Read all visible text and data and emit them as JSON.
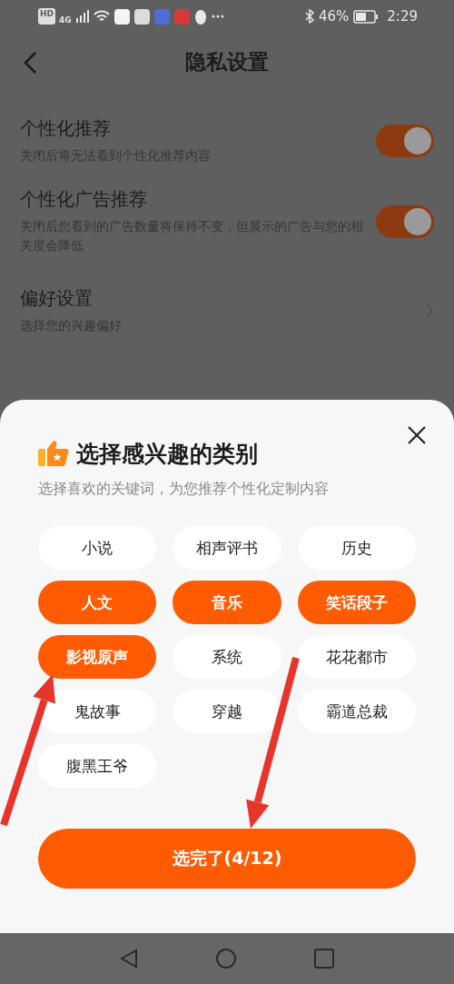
{
  "status_bar": {
    "indicators": [
      "HD",
      "4G"
    ],
    "battery": "46%",
    "time": "2:29"
  },
  "header": {
    "title": "隐私设置"
  },
  "settings": [
    {
      "kind": "toggle",
      "title": "个性化推荐",
      "subtitle": "关闭后将无法看到个性化推荐内容",
      "on": true
    },
    {
      "kind": "toggle",
      "title": "个性化广告推荐",
      "subtitle": "关闭后您看到的广告数量将保持不变，但展示的广告与您的相关度会降低",
      "on": true
    },
    {
      "kind": "link",
      "title": "偏好设置",
      "subtitle": "选择您的兴趣偏好"
    }
  ],
  "sheet": {
    "title": "选择感兴趣的类别",
    "subtitle": "选择喜欢的关键词，为您推荐个性化定制内容",
    "chips": [
      {
        "label": "小说",
        "selected": false
      },
      {
        "label": "相声评书",
        "selected": false
      },
      {
        "label": "历史",
        "selected": false
      },
      {
        "label": "人文",
        "selected": true
      },
      {
        "label": "音乐",
        "selected": true
      },
      {
        "label": "笑话段子",
        "selected": true
      },
      {
        "label": "影视原声",
        "selected": true
      },
      {
        "label": "系统",
        "selected": false
      },
      {
        "label": "花花都市",
        "selected": false
      },
      {
        "label": "鬼故事",
        "selected": false
      },
      {
        "label": "穿越",
        "selected": false
      },
      {
        "label": "霸道总裁",
        "selected": false
      },
      {
        "label": "腹黑王爷",
        "selected": false
      }
    ],
    "confirm_button": "选完了(4/12)"
  }
}
